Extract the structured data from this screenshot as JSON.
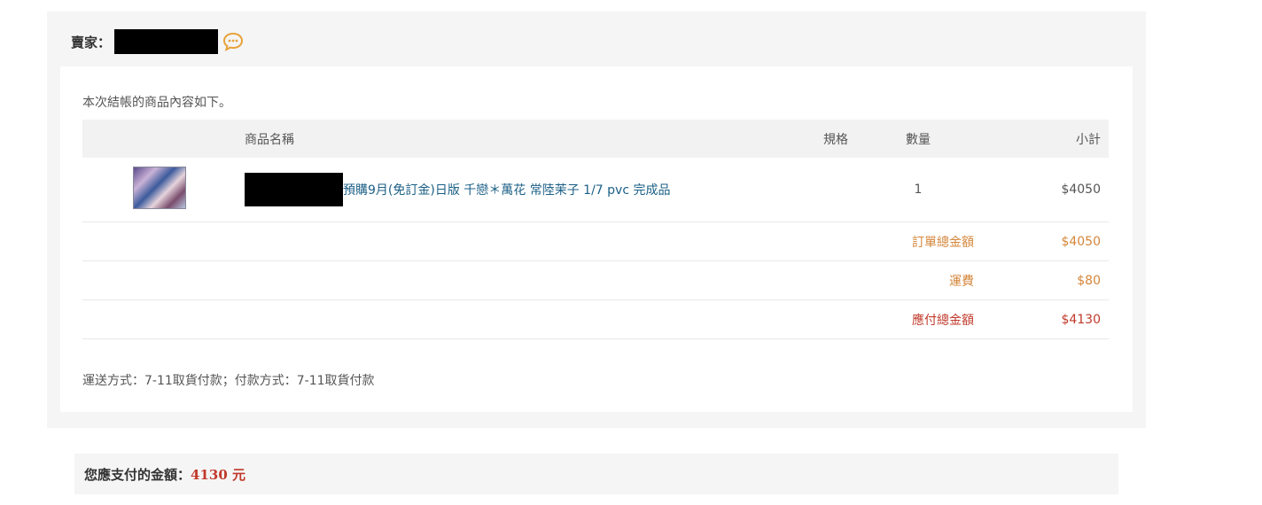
{
  "seller": {
    "label": "賣家："
  },
  "order": {
    "intro": "本次結帳的商品內容如下。",
    "columns": {
      "name": "商品名稱",
      "spec": "規格",
      "qty": "數量",
      "subtotal": "小計"
    },
    "items": [
      {
        "name": "預購9月(免訂金)日版 千戀＊萬花 常陸茉子 1/7 pvc 完成品",
        "spec": "",
        "qty": "1",
        "subtotal": "$4050"
      }
    ],
    "summary": [
      {
        "label": "訂單總金額",
        "value": "$4050"
      },
      {
        "label": "運費",
        "value": "$80"
      },
      {
        "label": "應付總金額",
        "value": "$4130"
      }
    ],
    "shipping_note": "運送方式：7-11取貨付款；付款方式：7-11取貨付款"
  },
  "payment": {
    "label": "您應支付的金額：",
    "amount": "4130 元"
  },
  "colors": {
    "accent_orange": "#d4863a",
    "total_red": "#c0392b",
    "link_blue": "#1b5f86"
  }
}
